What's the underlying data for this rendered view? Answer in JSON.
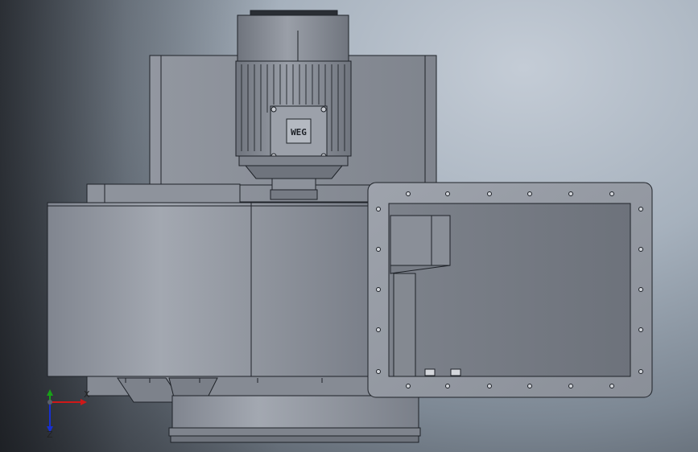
{
  "scene": {
    "subject": "centrifugal-fan-assembly-cad-model",
    "motor_nameplate_text": "WEG",
    "colors": {
      "metal": "#8a8f99",
      "metal_light": "#a6abb4",
      "metal_dark": "#5a5f68",
      "edge": "#1e2228",
      "axis_x": "#d01818",
      "axis_y": "#18a018",
      "axis_z": "#1830d0"
    }
  },
  "triad": {
    "x_label": "X",
    "y_label": "Y",
    "z_label": "Z"
  }
}
